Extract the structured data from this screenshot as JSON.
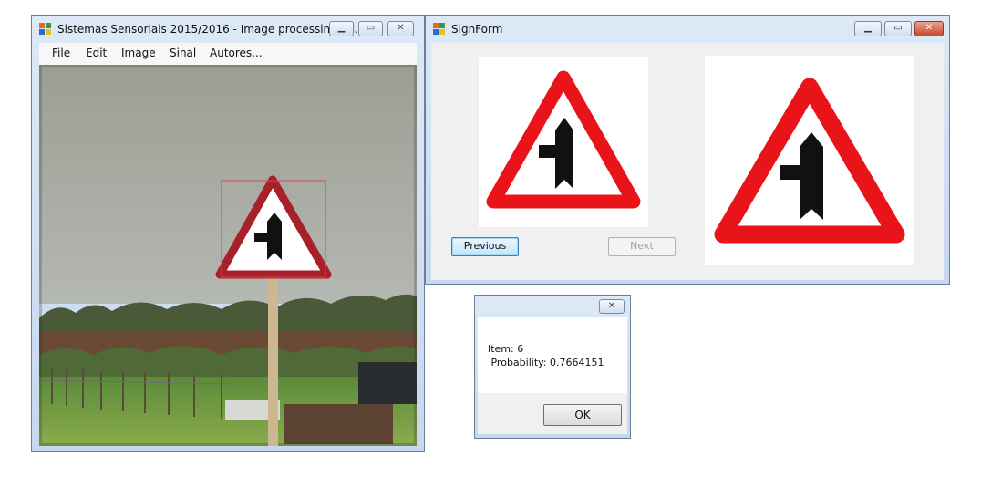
{
  "image_window": {
    "title": "Sistemas Sensoriais 2015/2016 - Image processing [Si...",
    "controls": [
      "minimize",
      "maximize",
      "close"
    ],
    "menu": [
      {
        "label": "File"
      },
      {
        "label": "Edit"
      },
      {
        "label": "Image"
      },
      {
        "label": "Sinal"
      },
      {
        "label": "Autores..."
      }
    ]
  },
  "sign_form": {
    "title": "SignForm",
    "previous_label": "Previous",
    "next_label": "Next"
  },
  "result_dialog": {
    "item_text": "Item: 6",
    "probability_text": " Probability: 0.7664151",
    "ok_label": "OK"
  },
  "colors": {
    "sign_red": "#e8141a",
    "detection_box": "#e0454d",
    "focus_blue": "#3c7fb1"
  },
  "icons": [
    "app-icon",
    "minimize-icon",
    "maximize-icon",
    "close-icon"
  ]
}
